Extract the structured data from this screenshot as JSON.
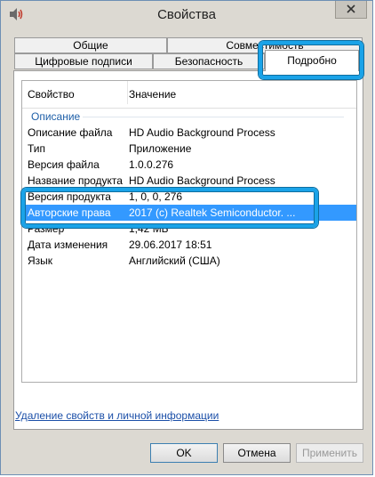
{
  "window": {
    "title": "Свойства"
  },
  "tabs": {
    "row1": [
      "Общие",
      "Совместимость"
    ],
    "row2": [
      "Цифровые подписи",
      "Безопасность",
      "Подробно"
    ]
  },
  "list": {
    "headers": {
      "property": "Свойство",
      "value": "Значение"
    },
    "group": "Описание",
    "rows": [
      {
        "property": "Описание файла",
        "value": "HD Audio Background Process"
      },
      {
        "property": "Тип",
        "value": "Приложение"
      },
      {
        "property": "Версия файла",
        "value": "1.0.0.276"
      },
      {
        "property": "Название продукта",
        "value": "HD Audio Background Process"
      },
      {
        "property": "Версия продукта",
        "value": "1, 0, 0, 276"
      },
      {
        "property": "Авторские права",
        "value": "2017 (c) Realtek Semiconductor. ..."
      },
      {
        "property": "Размер",
        "value": "1,42 МБ"
      },
      {
        "property": "Дата изменения",
        "value": "29.06.2017 18:51"
      },
      {
        "property": "Язык",
        "value": "Английский (США)"
      }
    ]
  },
  "link": "Удаление свойств и личной информации",
  "buttons": {
    "ok": "OK",
    "cancel": "Отмена",
    "apply": "Применить"
  },
  "colors": {
    "highlight": "#1aa3e8",
    "selection": "#3399ff",
    "group": "#1e5fa8",
    "link": "#1b4fa8"
  }
}
